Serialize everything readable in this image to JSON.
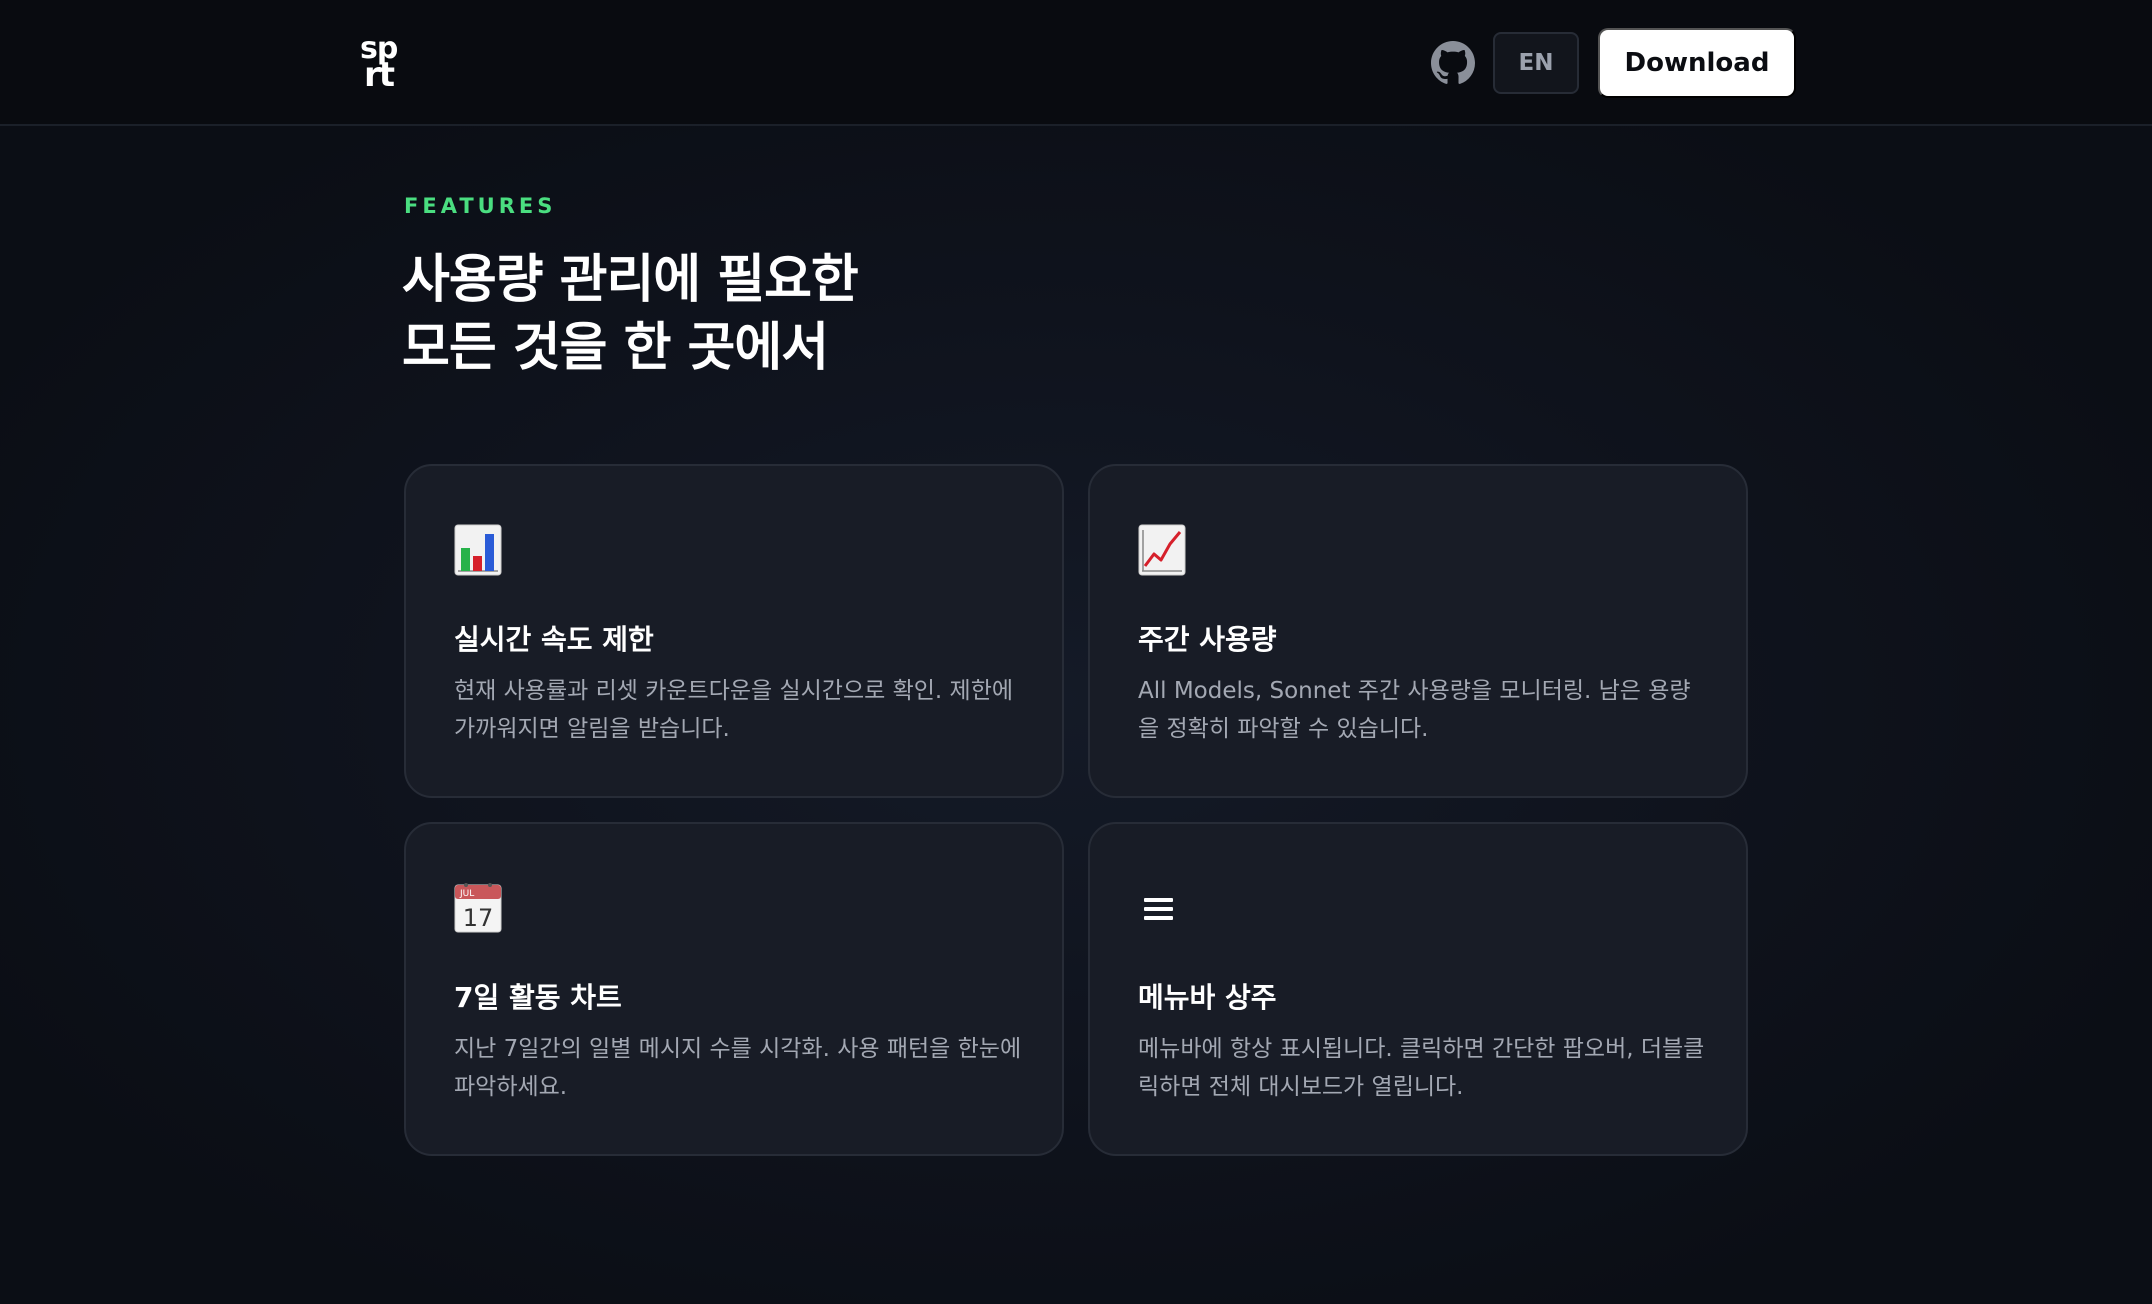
{
  "header": {
    "logo_line1": "sp",
    "logo_line2": "rt",
    "github_icon": "github-icon",
    "language_label": "EN",
    "download_label": "Download"
  },
  "features": {
    "eyebrow": "FEATURES",
    "headline_line1": "사용량 관리에 필요한",
    "headline_line2": "모든 것을 한 곳에서",
    "accent_color": "#4ade80",
    "cards": [
      {
        "icon": "bar-chart-icon",
        "title": "실시간 속도 제한",
        "description": "현재 사용률과 리셋 카운트다운을 실시간으로 확인. 제한에 가까워지면 알림을 받습니다."
      },
      {
        "icon": "line-chart-icon",
        "title": "주간 사용량",
        "description": "All Models, Sonnet 주간 사용량을 모니터링. 남은 용량을 정확히 파악할 수 있습니다."
      },
      {
        "icon": "calendar-icon",
        "calendar_month": "JUL",
        "calendar_day": "17",
        "title": "7일 활동 차트",
        "description": "지난 7일간의 일별 메시지 수를 시각화. 사용 패턴을 한눈에 파악하세요."
      },
      {
        "icon": "menu-icon",
        "title": "메뉴바 상주",
        "description": "메뉴바에 항상 표시됩니다. 클릭하면 간단한 팝오버, 더블클릭하면 전체 대시보드가 열립니다."
      }
    ]
  }
}
